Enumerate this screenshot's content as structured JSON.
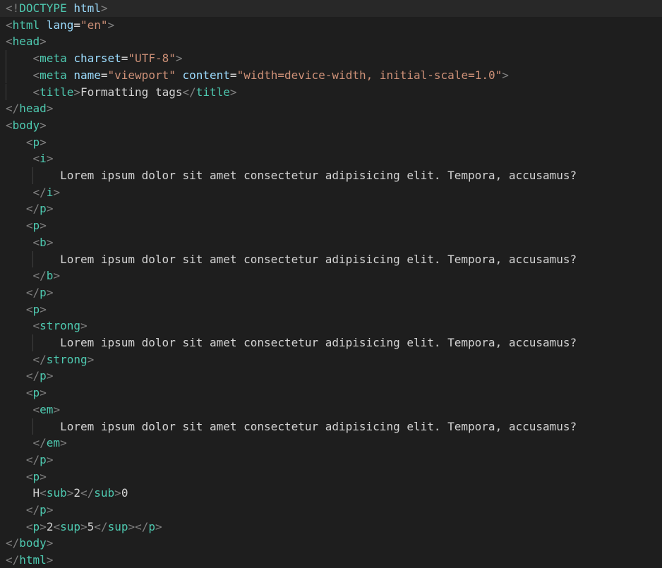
{
  "editor": {
    "language": "html",
    "colors": {
      "background": "#1e1e1e",
      "active_line": "#282828",
      "bracket": "#808080",
      "tag": "#4ec9b0",
      "attribute": "#9cdcfe",
      "string": "#ce9178",
      "text": "#d4d4d4",
      "doctype_keyword": "#569cd6"
    },
    "lines": [
      {
        "tokens": [
          {
            "t": "<!",
            "c": "bk"
          },
          {
            "t": "DOCTYPE",
            "c": "tg"
          },
          {
            "t": " ",
            "c": "tx"
          },
          {
            "t": "html",
            "c": "at"
          },
          {
            "t": ">",
            "c": "bk"
          }
        ]
      },
      {
        "tokens": [
          {
            "t": "<",
            "c": "bk"
          },
          {
            "t": "html",
            "c": "tg"
          },
          {
            "t": " ",
            "c": "tx"
          },
          {
            "t": "lang",
            "c": "at"
          },
          {
            "t": "=",
            "c": "tx"
          },
          {
            "t": "\"en\"",
            "c": "st"
          },
          {
            "t": ">",
            "c": "bk"
          }
        ]
      },
      {
        "tokens": [
          {
            "t": "<",
            "c": "bk"
          },
          {
            "t": "head",
            "c": "tg"
          },
          {
            "t": ">",
            "c": "bk"
          }
        ]
      },
      {
        "tokens": [
          {
            "t": "    ",
            "c": "tx"
          },
          {
            "t": "<",
            "c": "bk"
          },
          {
            "t": "meta",
            "c": "tg"
          },
          {
            "t": " ",
            "c": "tx"
          },
          {
            "t": "charset",
            "c": "at"
          },
          {
            "t": "=",
            "c": "tx"
          },
          {
            "t": "\"UTF-8\"",
            "c": "st"
          },
          {
            "t": ">",
            "c": "bk"
          }
        ]
      },
      {
        "tokens": [
          {
            "t": "    ",
            "c": "tx"
          },
          {
            "t": "<",
            "c": "bk"
          },
          {
            "t": "meta",
            "c": "tg"
          },
          {
            "t": " ",
            "c": "tx"
          },
          {
            "t": "name",
            "c": "at"
          },
          {
            "t": "=",
            "c": "tx"
          },
          {
            "t": "\"viewport\"",
            "c": "st"
          },
          {
            "t": " ",
            "c": "tx"
          },
          {
            "t": "content",
            "c": "at"
          },
          {
            "t": "=",
            "c": "tx"
          },
          {
            "t": "\"width=device-width, initial-scale=1.0\"",
            "c": "st"
          },
          {
            "t": ">",
            "c": "bk"
          }
        ]
      },
      {
        "tokens": [
          {
            "t": "    ",
            "c": "tx"
          },
          {
            "t": "<",
            "c": "bk"
          },
          {
            "t": "title",
            "c": "tg"
          },
          {
            "t": ">",
            "c": "bk"
          },
          {
            "t": "Formatting tags",
            "c": "tx"
          },
          {
            "t": "</",
            "c": "bk"
          },
          {
            "t": "title",
            "c": "tg"
          },
          {
            "t": ">",
            "c": "bk"
          }
        ]
      },
      {
        "tokens": [
          {
            "t": "</",
            "c": "bk"
          },
          {
            "t": "head",
            "c": "tg"
          },
          {
            "t": ">",
            "c": "bk"
          }
        ]
      },
      {
        "tokens": [
          {
            "t": "<",
            "c": "bk"
          },
          {
            "t": "body",
            "c": "tg"
          },
          {
            "t": ">",
            "c": "bk"
          }
        ]
      },
      {
        "tokens": [
          {
            "t": "   ",
            "c": "tx"
          },
          {
            "t": "<",
            "c": "bk"
          },
          {
            "t": "p",
            "c": "tg"
          },
          {
            "t": ">",
            "c": "bk"
          }
        ]
      },
      {
        "tokens": [
          {
            "t": "    ",
            "c": "tx"
          },
          {
            "t": "<",
            "c": "bk"
          },
          {
            "t": "i",
            "c": "tg"
          },
          {
            "t": ">",
            "c": "bk"
          }
        ]
      },
      {
        "tokens": [
          {
            "t": "        ",
            "c": "tx"
          },
          {
            "t": "Lorem ipsum dolor sit amet consectetur adipisicing elit. Tempora, accusamus?",
            "c": "tx"
          }
        ]
      },
      {
        "tokens": [
          {
            "t": "    ",
            "c": "tx"
          },
          {
            "t": "</",
            "c": "bk"
          },
          {
            "t": "i",
            "c": "tg"
          },
          {
            "t": ">",
            "c": "bk"
          }
        ]
      },
      {
        "tokens": [
          {
            "t": "   ",
            "c": "tx"
          },
          {
            "t": "</",
            "c": "bk"
          },
          {
            "t": "p",
            "c": "tg"
          },
          {
            "t": ">",
            "c": "bk"
          }
        ]
      },
      {
        "tokens": [
          {
            "t": "   ",
            "c": "tx"
          },
          {
            "t": "<",
            "c": "bk"
          },
          {
            "t": "p",
            "c": "tg"
          },
          {
            "t": ">",
            "c": "bk"
          }
        ]
      },
      {
        "tokens": [
          {
            "t": "    ",
            "c": "tx"
          },
          {
            "t": "<",
            "c": "bk"
          },
          {
            "t": "b",
            "c": "tg"
          },
          {
            "t": ">",
            "c": "bk"
          }
        ]
      },
      {
        "tokens": [
          {
            "t": "        ",
            "c": "tx"
          },
          {
            "t": "Lorem ipsum dolor sit amet consectetur adipisicing elit. Tempora, accusamus?",
            "c": "tx"
          }
        ]
      },
      {
        "tokens": [
          {
            "t": "    ",
            "c": "tx"
          },
          {
            "t": "</",
            "c": "bk"
          },
          {
            "t": "b",
            "c": "tg"
          },
          {
            "t": ">",
            "c": "bk"
          }
        ]
      },
      {
        "tokens": [
          {
            "t": "   ",
            "c": "tx"
          },
          {
            "t": "</",
            "c": "bk"
          },
          {
            "t": "p",
            "c": "tg"
          },
          {
            "t": ">",
            "c": "bk"
          }
        ]
      },
      {
        "tokens": [
          {
            "t": "   ",
            "c": "tx"
          },
          {
            "t": "<",
            "c": "bk"
          },
          {
            "t": "p",
            "c": "tg"
          },
          {
            "t": ">",
            "c": "bk"
          }
        ]
      },
      {
        "tokens": [
          {
            "t": "    ",
            "c": "tx"
          },
          {
            "t": "<",
            "c": "bk"
          },
          {
            "t": "strong",
            "c": "tg"
          },
          {
            "t": ">",
            "c": "bk"
          }
        ]
      },
      {
        "tokens": [
          {
            "t": "        ",
            "c": "tx"
          },
          {
            "t": "Lorem ipsum dolor sit amet consectetur adipisicing elit. Tempora, accusamus?",
            "c": "tx"
          }
        ]
      },
      {
        "tokens": [
          {
            "t": "    ",
            "c": "tx"
          },
          {
            "t": "</",
            "c": "bk"
          },
          {
            "t": "strong",
            "c": "tg"
          },
          {
            "t": ">",
            "c": "bk"
          }
        ]
      },
      {
        "tokens": [
          {
            "t": "   ",
            "c": "tx"
          },
          {
            "t": "</",
            "c": "bk"
          },
          {
            "t": "p",
            "c": "tg"
          },
          {
            "t": ">",
            "c": "bk"
          }
        ]
      },
      {
        "tokens": [
          {
            "t": "   ",
            "c": "tx"
          },
          {
            "t": "<",
            "c": "bk"
          },
          {
            "t": "p",
            "c": "tg"
          },
          {
            "t": ">",
            "c": "bk"
          }
        ]
      },
      {
        "tokens": [
          {
            "t": "    ",
            "c": "tx"
          },
          {
            "t": "<",
            "c": "bk"
          },
          {
            "t": "em",
            "c": "tg"
          },
          {
            "t": ">",
            "c": "bk"
          }
        ]
      },
      {
        "tokens": [
          {
            "t": "        ",
            "c": "tx"
          },
          {
            "t": "Lorem ipsum dolor sit amet consectetur adipisicing elit. Tempora, accusamus?",
            "c": "tx"
          }
        ]
      },
      {
        "tokens": [
          {
            "t": "    ",
            "c": "tx"
          },
          {
            "t": "</",
            "c": "bk"
          },
          {
            "t": "em",
            "c": "tg"
          },
          {
            "t": ">",
            "c": "bk"
          }
        ]
      },
      {
        "tokens": [
          {
            "t": "   ",
            "c": "tx"
          },
          {
            "t": "</",
            "c": "bk"
          },
          {
            "t": "p",
            "c": "tg"
          },
          {
            "t": ">",
            "c": "bk"
          }
        ]
      },
      {
        "tokens": [
          {
            "t": "   ",
            "c": "tx"
          },
          {
            "t": "<",
            "c": "bk"
          },
          {
            "t": "p",
            "c": "tg"
          },
          {
            "t": ">",
            "c": "bk"
          }
        ]
      },
      {
        "tokens": [
          {
            "t": "    ",
            "c": "tx"
          },
          {
            "t": "H",
            "c": "tx"
          },
          {
            "t": "<",
            "c": "bk"
          },
          {
            "t": "sub",
            "c": "tg"
          },
          {
            "t": ">",
            "c": "bk"
          },
          {
            "t": "2",
            "c": "tx"
          },
          {
            "t": "</",
            "c": "bk"
          },
          {
            "t": "sub",
            "c": "tg"
          },
          {
            "t": ">",
            "c": "bk"
          },
          {
            "t": "0",
            "c": "tx"
          }
        ]
      },
      {
        "tokens": [
          {
            "t": "   ",
            "c": "tx"
          },
          {
            "t": "</",
            "c": "bk"
          },
          {
            "t": "p",
            "c": "tg"
          },
          {
            "t": ">",
            "c": "bk"
          }
        ]
      },
      {
        "tokens": [
          {
            "t": "   ",
            "c": "tx"
          },
          {
            "t": "<",
            "c": "bk"
          },
          {
            "t": "p",
            "c": "tg"
          },
          {
            "t": ">",
            "c": "bk"
          },
          {
            "t": "2",
            "c": "tx"
          },
          {
            "t": "<",
            "c": "bk"
          },
          {
            "t": "sup",
            "c": "tg"
          },
          {
            "t": ">",
            "c": "bk"
          },
          {
            "t": "5",
            "c": "tx"
          },
          {
            "t": "</",
            "c": "bk"
          },
          {
            "t": "sup",
            "c": "tg"
          },
          {
            "t": ">",
            "c": "bk"
          },
          {
            "t": "</",
            "c": "bk"
          },
          {
            "t": "p",
            "c": "tg"
          },
          {
            "t": ">",
            "c": "bk"
          }
        ]
      },
      {
        "tokens": [
          {
            "t": "</",
            "c": "bk"
          },
          {
            "t": "body",
            "c": "tg"
          },
          {
            "t": ">",
            "c": "bk"
          }
        ]
      },
      {
        "tokens": [
          {
            "t": "</",
            "c": "bk"
          },
          {
            "t": "html",
            "c": "tg"
          },
          {
            "t": ">",
            "c": "bk"
          }
        ]
      }
    ]
  }
}
